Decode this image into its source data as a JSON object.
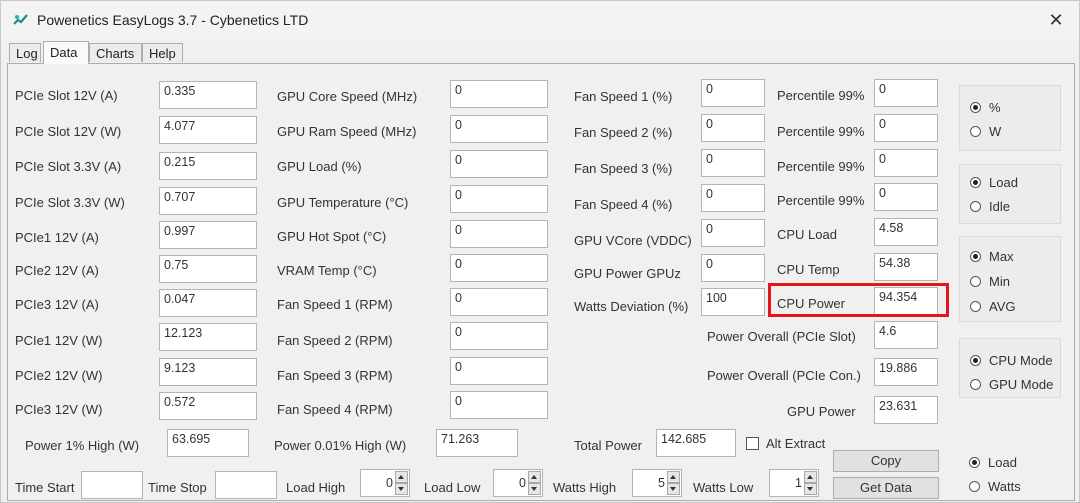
{
  "window": {
    "title": "Powenetics EasyLogs 3.7 - Cybenetics LTD",
    "close_symbol": "✕",
    "accent": "#e8131b",
    "icon_color": "#1a8f7c"
  },
  "tabs": [
    "Log",
    "Data",
    "Charts",
    "Help"
  ],
  "col1": [
    {
      "label": "PCIe Slot 12V (A)",
      "value": "0.335"
    },
    {
      "label": "PCIe Slot 12V (W)",
      "value": "4.077"
    },
    {
      "label": "PCIe Slot 3.3V (A)",
      "value": "0.215"
    },
    {
      "label": "PCIe Slot 3.3V (W)",
      "value": "0.707"
    },
    {
      "label": "PCIe1 12V (A)",
      "value": "0.997"
    },
    {
      "label": "PCIe2 12V (A)",
      "value": "0.75"
    },
    {
      "label": "PCIe3 12V (A)",
      "value": "0.047"
    },
    {
      "label": "PCIe1 12V (W)",
      "value": "12.123"
    },
    {
      "label": "PCIe2 12V (W)",
      "value": "9.123"
    },
    {
      "label": "PCIe3 12V (W)",
      "value": "0.572"
    }
  ],
  "col2": [
    {
      "label": "GPU Core Speed (MHz)",
      "value": "0"
    },
    {
      "label": "GPU Ram Speed (MHz)",
      "value": "0"
    },
    {
      "label": "GPU Load (%)",
      "value": "0"
    },
    {
      "label": "GPU Temperature (°C)",
      "value": "0"
    },
    {
      "label": "GPU Hot Spot (°C)",
      "value": "0"
    },
    {
      "label": "VRAM Temp (°C)",
      "value": "0"
    },
    {
      "label": "Fan Speed 1 (RPM)",
      "value": "0"
    },
    {
      "label": "Fan Speed 2 (RPM)",
      "value": "0"
    },
    {
      "label": "Fan Speed 3 (RPM)",
      "value": "0"
    },
    {
      "label": "Fan Speed 4 (RPM)",
      "value": "0"
    }
  ],
  "col3": [
    {
      "label": "Fan Speed 1 (%)",
      "value": "0"
    },
    {
      "label": "Fan Speed 2 (%)",
      "value": "0"
    },
    {
      "label": "Fan Speed 3 (%)",
      "value": "0"
    },
    {
      "label": "Fan Speed 4 (%)",
      "value": "0"
    },
    {
      "label": "GPU VCore (VDDC)",
      "value": "0"
    },
    {
      "label": "GPU Power GPUz",
      "value": "0"
    },
    {
      "label": "Watts Deviation (%)",
      "value": "100"
    }
  ],
  "col4": [
    {
      "label": "Percentile 99%",
      "value": "0"
    },
    {
      "label": "Percentile 99%",
      "value": "0"
    },
    {
      "label": "Percentile 99%",
      "value": "0"
    },
    {
      "label": "Percentile 99%",
      "value": "0"
    },
    {
      "label": "CPU Load",
      "value": "4.58"
    },
    {
      "label": "CPU Temp",
      "value": "54.38"
    },
    {
      "label": "CPU Power",
      "value": "94.354"
    },
    {
      "label": "Power Overall (PCIe Slot)",
      "value": "4.6"
    },
    {
      "label": "Power Overall (PCIe Con.)",
      "value": "19.886"
    },
    {
      "label": "GPU Power",
      "value": "23.631"
    }
  ],
  "bottom_stats": [
    {
      "label": "Power 1% High (W)",
      "value": "63.695"
    },
    {
      "label": "Power 0.01% High (W)",
      "value": "71.263"
    },
    {
      "label": "Total Power",
      "value": "142.685"
    }
  ],
  "alt_extract_label": "Alt Extract",
  "buttons": {
    "copy": "Copy",
    "get_data": "Get Data"
  },
  "options": {
    "unit": [
      {
        "label": "%",
        "selected": true
      },
      {
        "label": "W",
        "selected": false
      }
    ],
    "state": [
      {
        "label": "Load",
        "selected": true
      },
      {
        "label": "Idle",
        "selected": false
      }
    ],
    "stat": [
      {
        "label": "Max",
        "selected": true
      },
      {
        "label": "Min",
        "selected": false
      },
      {
        "label": "AVG",
        "selected": false
      }
    ],
    "mode": [
      {
        "label": "CPU Mode",
        "selected": true
      },
      {
        "label": "GPU Mode",
        "selected": false
      }
    ],
    "source": [
      {
        "label": "Load",
        "selected": true
      },
      {
        "label": "Watts",
        "selected": false
      }
    ]
  },
  "controls": {
    "time_start": {
      "label": "Time Start",
      "value": ""
    },
    "time_stop": {
      "label": "Time Stop",
      "value": ""
    },
    "load_high": {
      "label": "Load High",
      "value": "0"
    },
    "load_low": {
      "label": "Load Low",
      "value": "0"
    },
    "watts_high": {
      "label": "Watts High",
      "value": "5"
    },
    "watts_low": {
      "label": "Watts Low",
      "value": "1"
    }
  }
}
